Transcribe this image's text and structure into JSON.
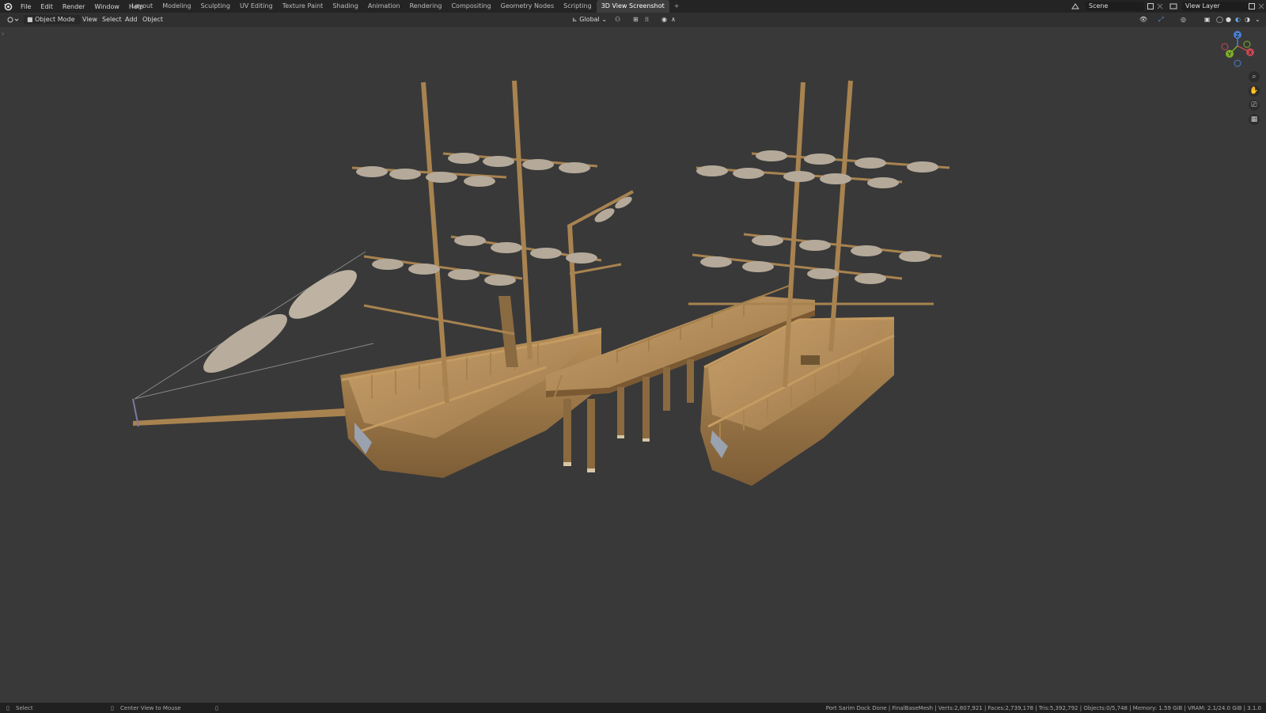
{
  "menu": [
    "File",
    "Edit",
    "Render",
    "Window",
    "Help"
  ],
  "workspaces": [
    "Layout",
    "Modeling",
    "Sculpting",
    "UV Editing",
    "Texture Paint",
    "Shading",
    "Animation",
    "Rendering",
    "Compositing",
    "Geometry Nodes",
    "Scripting",
    "3D View Screenshot"
  ],
  "active_workspace": "3D View Screenshot",
  "add_tab": "+",
  "scene": "Scene",
  "view_layer": "View Layer",
  "header": {
    "mode": "Object Mode",
    "view": "View",
    "select": "Select",
    "add": "Add",
    "object": "Object",
    "orientation": "Global"
  },
  "gizmo": {
    "x": "X",
    "y": "Y",
    "z": "Z"
  },
  "status": {
    "left": "Select",
    "middle": "Center View to Mouse",
    "stats": "Port Sarim Dock Done | FinalBaseMesh | Verts:2,807,921 | Faces:2,739,178 | Tris:5,392,792 | Objects:0/5,748 | Memory: 1.59 GiB | VRAM: 2.1/24.0 GiB | 3.1.0"
  },
  "colors": {
    "wood": "#b38b55",
    "sail": "#b5aa9a",
    "bg": "#393939"
  }
}
